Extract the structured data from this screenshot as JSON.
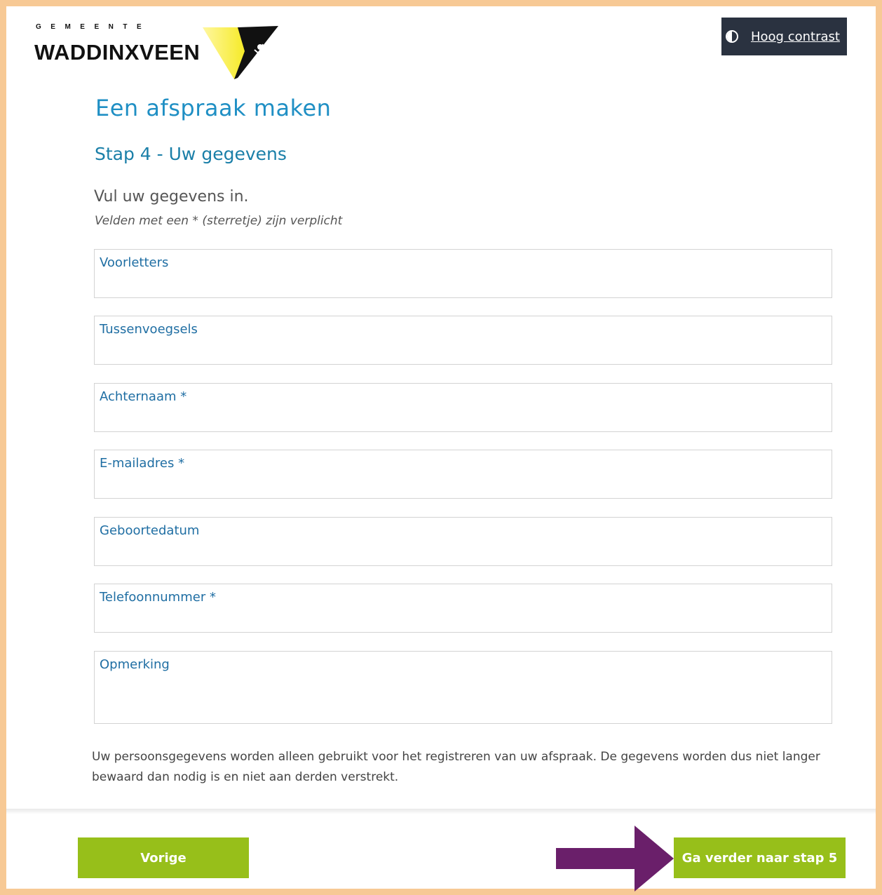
{
  "header": {
    "logo_small": "GEMEENTE",
    "logo_big": "WADDINXVEEN",
    "contrast_label": "Hoog contrast"
  },
  "page": {
    "title": "Een afspraak maken",
    "step": "Stap 4 - Uw gegevens",
    "intro": "Vul uw gegevens in.",
    "note": "Velden met een * (sterretje) zijn verplicht"
  },
  "fields": [
    {
      "label": "Voorletters",
      "value": ""
    },
    {
      "label": "Tussenvoegsels",
      "value": ""
    },
    {
      "label": "Achternaam *",
      "value": ""
    },
    {
      "label": "E-mailadres *",
      "value": ""
    },
    {
      "label": "Geboortedatum",
      "value": ""
    },
    {
      "label": "Telefoonnummer *",
      "value": ""
    },
    {
      "label": "Opmerking",
      "value": ""
    }
  ],
  "privacy_text": "Uw persoonsgegevens worden alleen gebruikt voor het registreren van uw afspraak. De gegevens worden dus niet langer bewaard dan nodig is en niet aan derden verstrekt.",
  "buttons": {
    "prev_label": "Vorige",
    "next_label": "Ga verder naar stap 5"
  },
  "colors": {
    "frame_border": "#f7c995",
    "title_blue": "#1f8fc4",
    "label_blue": "#1f6ea3",
    "button_green": "#97bf1a",
    "contrast_bg": "#2a3240",
    "arrow_purple": "#6a1f6a"
  },
  "icons": {
    "contrast": "half-circle-contrast-icon",
    "annotation_arrow": "right-arrow-icon"
  }
}
